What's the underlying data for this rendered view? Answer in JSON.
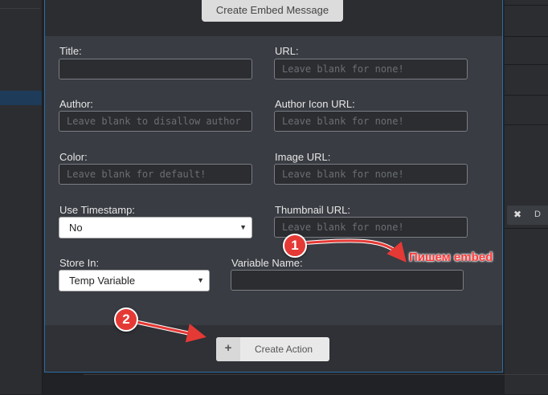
{
  "dialog": {
    "header_button": "Create Embed Message",
    "fields": {
      "title": {
        "label": "Title:",
        "placeholder": ""
      },
      "url": {
        "label": "URL:",
        "placeholder": "Leave blank for none!"
      },
      "author": {
        "label": "Author:",
        "placeholder": "Leave blank to disallow author"
      },
      "author_icon_url": {
        "label": "Author Icon URL:",
        "placeholder": "Leave blank for none!"
      },
      "color": {
        "label": "Color:",
        "placeholder": "Leave blank for default!"
      },
      "image_url": {
        "label": "Image URL:",
        "placeholder": "Leave blank for none!"
      },
      "use_timestamp": {
        "label": "Use Timestamp:",
        "value": "No"
      },
      "thumbnail_url": {
        "label": "Thumbnail URL:",
        "placeholder": "Leave blank for none!"
      },
      "store_in": {
        "label": "Store In:",
        "value": "Temp Variable"
      },
      "variable_name": {
        "label": "Variable Name:",
        "value": ""
      }
    },
    "create_action": {
      "icon": "plus-icon",
      "label": "Create Action"
    }
  },
  "background": {
    "right_tab": {
      "close_glyph": "✖",
      "partial_label": "D"
    }
  },
  "annotations": {
    "step1": {
      "number": "1",
      "note": "Пишем embed"
    },
    "step2": {
      "number": "2"
    },
    "color": "#e53935"
  }
}
